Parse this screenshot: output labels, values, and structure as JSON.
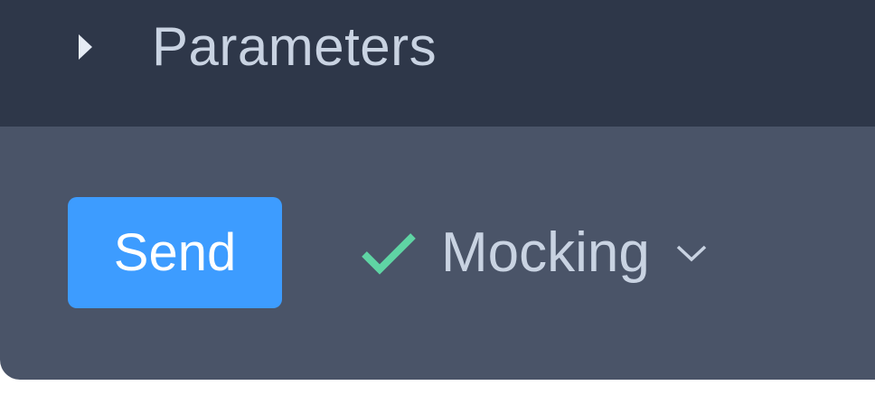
{
  "parameters": {
    "title": "Parameters",
    "icon": "caret-right-icon"
  },
  "toolbar": {
    "send_label": "Send",
    "mocking": {
      "label": "Mocking",
      "status_icon": "check-icon",
      "dropdown_icon": "chevron-down-icon",
      "enabled": true
    }
  },
  "colors": {
    "header_bg": "#2e3749",
    "toolbar_bg": "#4a5468",
    "send_bg": "#3d9cff",
    "check": "#5fd4a4",
    "text_muted": "#c9d3e2"
  }
}
